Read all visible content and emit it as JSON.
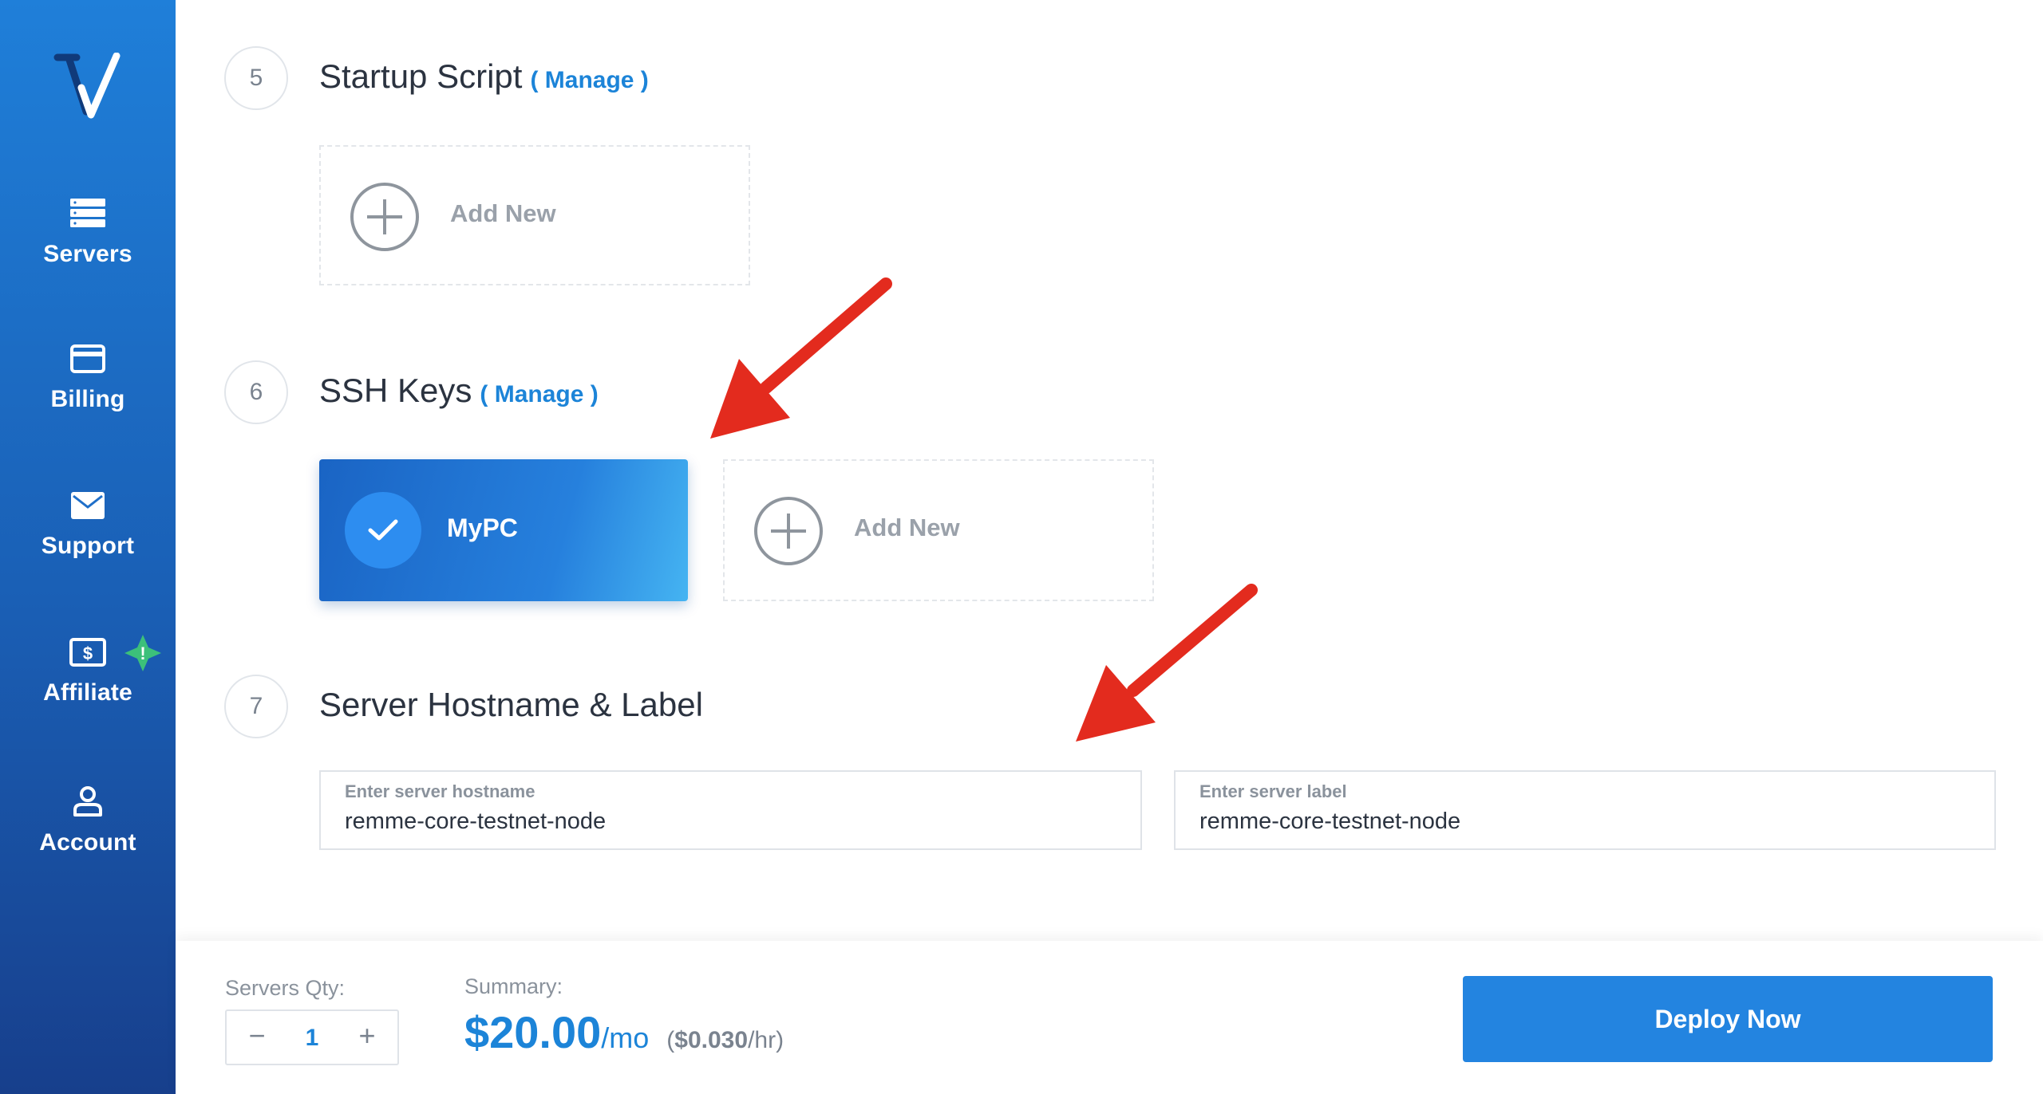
{
  "sidebar": {
    "items": [
      {
        "label": "Servers",
        "icon": "server-icon"
      },
      {
        "label": "Billing",
        "icon": "credit-card-icon"
      },
      {
        "label": "Support",
        "icon": "envelope-icon"
      },
      {
        "label": "Affiliate",
        "icon": "dollar-bill-icon"
      },
      {
        "label": "Account",
        "icon": "user-icon"
      }
    ],
    "affiliate_badge": "!"
  },
  "sections": {
    "startup": {
      "number": "5",
      "title": "Startup Script",
      "manage": "( Manage )",
      "add_new": "Add New"
    },
    "ssh": {
      "number": "6",
      "title": "SSH Keys",
      "manage": "( Manage )",
      "key_name": "MyPC",
      "add_new": "Add New"
    },
    "hostname": {
      "number": "7",
      "title": "Server Hostname & Label",
      "hostname_label": "Enter server hostname",
      "hostname_value": "remme-core-testnet-node",
      "label_label": "Enter server label",
      "label_value": "remme-core-testnet-node"
    }
  },
  "footer": {
    "qty_label": "Servers Qty:",
    "qty_minus": "−",
    "qty_value": "1",
    "qty_plus": "+",
    "summary_label": "Summary:",
    "price": "$20.00",
    "price_unit": "/mo",
    "hourly_open": "(",
    "hourly_price": "$0.030",
    "hourly_unit": "/hr)",
    "deploy_label": "Deploy Now"
  },
  "colors": {
    "accent": "#2384e0",
    "sidebar": "#1a5fb5",
    "arrow": "#e32b1e"
  }
}
